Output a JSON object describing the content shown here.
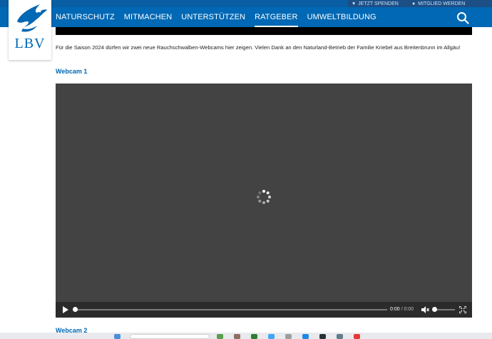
{
  "header": {
    "top_buttons": [
      {
        "label": "JETZT SPENDEN",
        "icon": "heart-hand-icon"
      },
      {
        "label": "MITGLIED WERDEN",
        "icon": "people-icon"
      }
    ],
    "logo_text": "LBV",
    "nav": [
      {
        "label": "NATURSCHUTZ",
        "active": false
      },
      {
        "label": "MITMACHEN",
        "active": false
      },
      {
        "label": "UNTERSTÜTZEN",
        "active": false
      },
      {
        "label": "RATGEBER",
        "active": true
      },
      {
        "label": "UMWELTBILDUNG",
        "active": false
      }
    ],
    "search_icon": "search-icon"
  },
  "content": {
    "intro": "Für die Saison 2024 dürfen wir zwei neue Rauchschwalben-Webcams hier zeigen. Vielen Dank an den Naturland-Betrieb der Familie Kriebel aus Breitenbrunn im Allgäu!",
    "webcam1_heading": "Webcam 1",
    "webcam2_heading": "Webcam 2"
  },
  "player": {
    "state": "loading",
    "current_time": "0:00",
    "separator": " / ",
    "duration": "0:00",
    "progress": 0,
    "volume": 0,
    "icons": [
      "play-icon",
      "volume-icon",
      "fullscreen-icon",
      "loading-spinner-icon"
    ]
  },
  "colors": {
    "brand_blue": "#0068b4",
    "player_bg": "#434343",
    "controls_bg": "#2b2b2b"
  }
}
